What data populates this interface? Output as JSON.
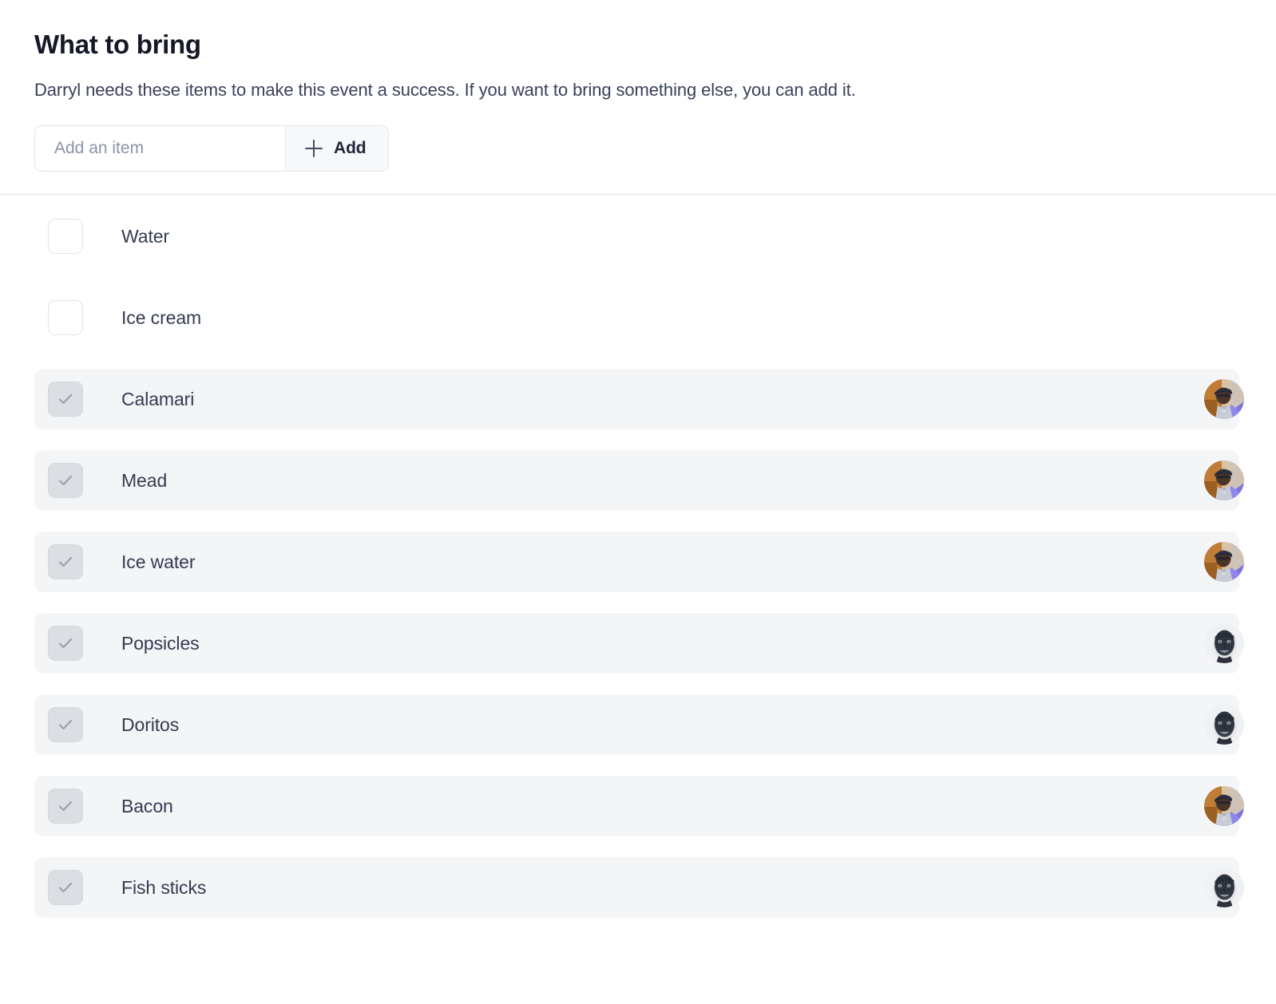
{
  "header": {
    "title": "What to bring",
    "description": "Darryl needs these items to make this event a success. If you want to bring something else, you can add it."
  },
  "add_control": {
    "input_value": "",
    "placeholder": "Add an item",
    "button_label": "Add",
    "button_icon": "plus-icon"
  },
  "colors": {
    "page_background": "#ffffff",
    "title_text": "#141827",
    "body_text": "#39415a",
    "item_text": "#333c50",
    "placeholder_text": "#8d93a5",
    "checked_row_background": "#f4f5f7",
    "checkbox_border": "#e2e4ea",
    "checkbox_checked_fill": "#dcdee3",
    "checkmark": "#9ba1ad",
    "divider": "#e4e5ec",
    "add_button_background": "#f7f8f9"
  },
  "list": {
    "items": [
      {
        "label": "Water",
        "checked": false,
        "avatar": null
      },
      {
        "label": "Ice cream",
        "checked": false,
        "avatar": null
      },
      {
        "label": "Calamari",
        "checked": true,
        "avatar": "person-cap-purple-avatar"
      },
      {
        "label": "Mead",
        "checked": true,
        "avatar": "person-cap-purple-avatar"
      },
      {
        "label": "Ice water",
        "checked": true,
        "avatar": "person-cap-purple-avatar"
      },
      {
        "label": "Popsicles",
        "checked": true,
        "avatar": "face-grayscale-avatar"
      },
      {
        "label": "Doritos",
        "checked": true,
        "avatar": "face-grayscale-avatar"
      },
      {
        "label": "Bacon",
        "checked": true,
        "avatar": "person-cap-purple-avatar"
      },
      {
        "label": "Fish sticks",
        "checked": true,
        "avatar": "face-grayscale-avatar"
      }
    ]
  }
}
